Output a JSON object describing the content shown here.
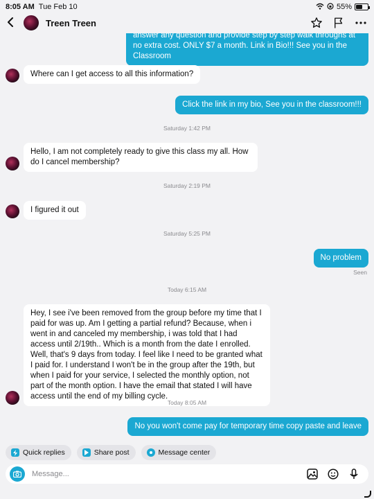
{
  "status_bar": {
    "time": "8:05 AM",
    "date": "Tue Feb 10",
    "battery": "55%",
    "battery_level": 0.55
  },
  "header": {
    "name": "Treen Treen"
  },
  "messages": {
    "out1": "answer any question and provide step by step walk throughs at no extra cost. ONLY $7 a month. Link in Bio!!! See you in the Classroom",
    "in1": "Where can I get access to all this information?",
    "out2": "Click the link in my bio, See you in the classroom!!!",
    "ts1": "Saturday 1:42 PM",
    "in2": "Hello, I am not completely ready to give this class my all. How do I cancel membership?",
    "ts2": "Saturday 2:19 PM",
    "in3": "I figured it out",
    "ts3": "Saturday 5:25 PM",
    "out3": "No problem",
    "seen": "Seen",
    "ts4": "Today 6:15 AM",
    "in4": "Hey, I see i've been removed from the group before my time that I paid for was up. Am I getting a partial refund? Because, when i went in and canceled my membership, i was told that I had access until 2/19th.. Which is a month from the date I enrolled. Well, that's 9 days from today. I feel like I need to be granted what I paid for. I understand I won't be in the group after the 19th, but when I paid for your service, I selected the monthly option, not part of the month option. I have the email that stated I will have access until the end of my billing cycle.",
    "ts5": "Today 8:05 AM",
    "out4": "No you won't come pay for temporary time copy paste and leave"
  },
  "quick_actions": {
    "quick_replies": "Quick replies",
    "share_post": "Share post",
    "message_center": "Message center"
  },
  "composer": {
    "placeholder": "Message..."
  },
  "colors": {
    "accent": "#1ba8d2",
    "background": "#f2f2f4",
    "incoming_bubble": "#ffffff"
  }
}
